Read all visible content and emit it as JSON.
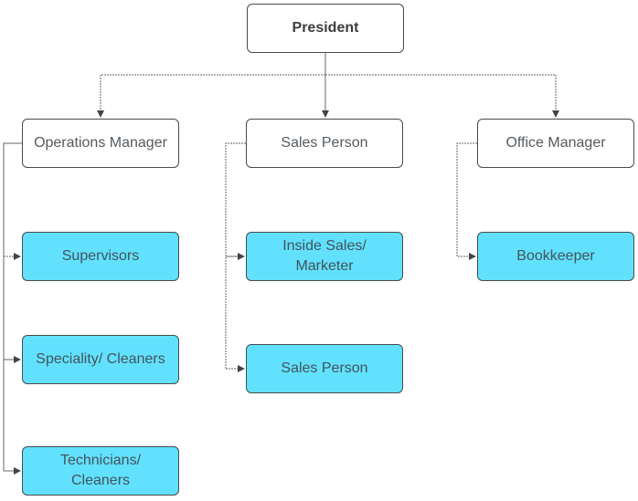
{
  "diagram": {
    "type": "org-chart",
    "colors": {
      "leaf_fill": "#61e1fd",
      "manager_fill": "#ffffff",
      "border": "#4a4a4a",
      "connector": "#555555"
    },
    "root": {
      "label": "President"
    },
    "managers": [
      {
        "label": "Operations Manager",
        "reports": [
          "Supervisors",
          "Speciality/ Cleaners",
          "Technicians/ Cleaners"
        ]
      },
      {
        "label": "Sales Person",
        "reports": [
          "Inside Sales/ Marketer",
          "Sales Person"
        ]
      },
      {
        "label": "Office Manager",
        "reports": [
          "Bookkeeper"
        ]
      }
    ]
  }
}
